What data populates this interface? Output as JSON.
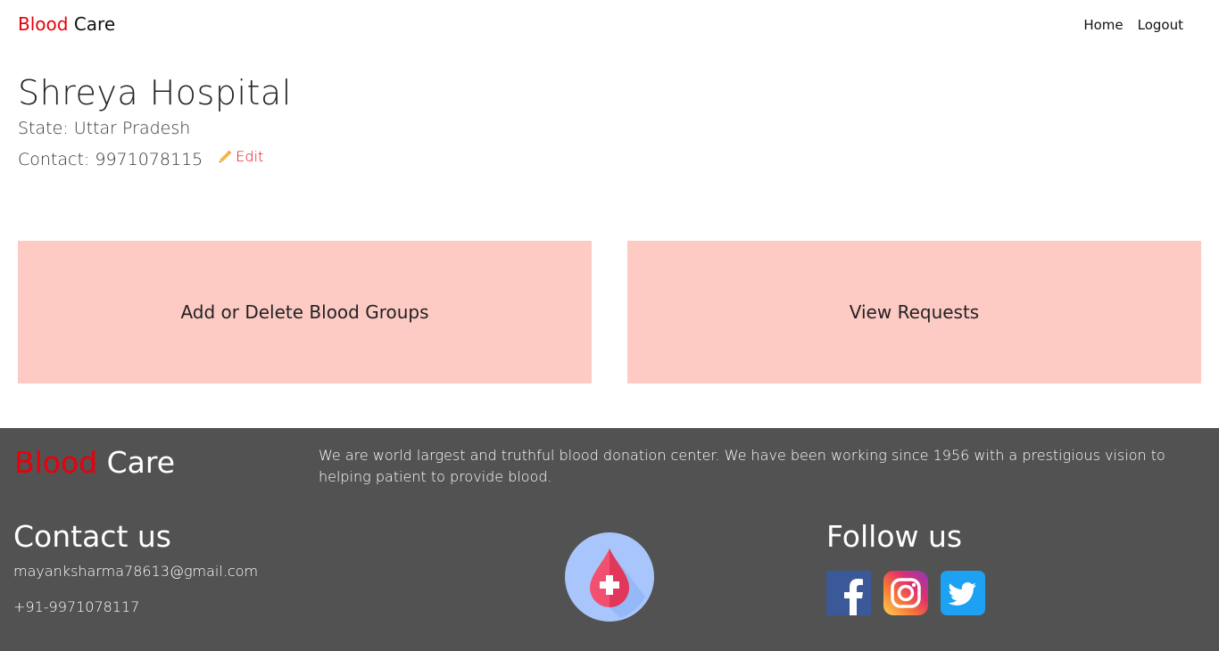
{
  "nav": {
    "brand_part1": "Blood",
    "brand_part2": "Care",
    "home": "Home",
    "logout": "Logout"
  },
  "profile": {
    "name": "Shreya Hospital",
    "state": "State: Uttar Pradesh",
    "contact": "Contact: 9971078115",
    "edit_label": "Edit"
  },
  "cards": {
    "left": "Add or Delete Blood Groups",
    "right": "View Requests"
  },
  "footer": {
    "brand_part1": "Blood",
    "brand_part2": "Care",
    "description": "We are world largest and truthful blood donation center. We have been working since 1956 with a prestigious vision to helping patient to provide blood.",
    "contact_title": "Contact us",
    "email": "mayanksharma78613@gmail.com",
    "phone": "+91-9971078117",
    "follow_title": "Follow us"
  },
  "colors": {
    "accent_red": "#e8000b",
    "card_bg": "#fdcbc4",
    "footer_bg": "#525252"
  },
  "icons": [
    "pencil-icon",
    "blood-drop-logo",
    "facebook-icon",
    "instagram-icon",
    "twitter-icon"
  ]
}
